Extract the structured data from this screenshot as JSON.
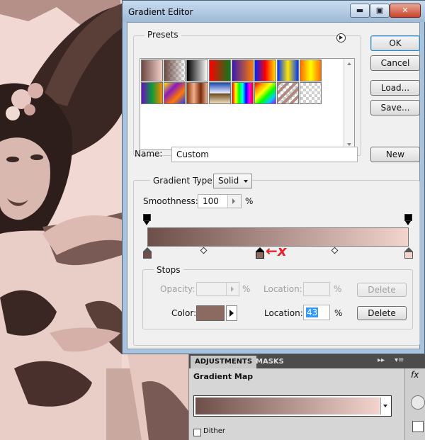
{
  "dialog": {
    "title": "Gradient Editor",
    "window_buttons": {
      "minimize": "▬",
      "maximize": "▣",
      "close": "✕"
    }
  },
  "presets": {
    "label": "Presets",
    "menu_icon": "circle-arrow-icon",
    "swatches": [
      {
        "name": "foreground-to-background",
        "css": "linear-gradient(90deg,#6b4a44,#f2d2cb)"
      },
      {
        "name": "foreground-to-transparent",
        "css": "linear-gradient(90deg,#6b4a44,rgba(107,74,68,0))",
        "checker": true
      },
      {
        "name": "black-white",
        "css": "linear-gradient(90deg,#000,#fff)"
      },
      {
        "name": "red-green",
        "css": "linear-gradient(90deg,#ff0000,#0a7a1a)"
      },
      {
        "name": "violet-orange",
        "css": "linear-gradient(90deg,#3a1ab0,#ff7a00)"
      },
      {
        "name": "blue-red-yellow",
        "css": "linear-gradient(90deg,#0022ff,#ff0000,#ffe600)"
      },
      {
        "name": "blue-yellow-blue",
        "css": "linear-gradient(90deg,#0038ff,#ffe600,#0038ff)"
      },
      {
        "name": "orange-yellow-orange",
        "css": "linear-gradient(90deg,#ff6a00,#ffff00,#ff6a00)"
      },
      {
        "name": "violet-green-orange",
        "css": "linear-gradient(90deg,#6a0fbf,#0a9a3a,#ff8a00)"
      },
      {
        "name": "yellow-violet-orange-blue",
        "css": "linear-gradient(135deg,#ffe600,#8a1ac0,#ff7a00,#1a3aff)"
      },
      {
        "name": "copper",
        "css": "linear-gradient(90deg,#8a3a12,#f2b08a,#7a2a0a,#f0c0a0)"
      },
      {
        "name": "chrome",
        "css": "linear-gradient(180deg,#1a4ab0,#f0f0ff 50%,#6a4a20 52%,#f0e0c0)"
      },
      {
        "name": "spectrum",
        "css": "linear-gradient(90deg,#ff0000,#ffff00,#00ff00,#00ffff,#0000ff,#ff00ff,#ff0000)"
      },
      {
        "name": "transparent-rainbow",
        "css": "linear-gradient(135deg,#ff0000,#ff9900,#ffff00,#00ff00,#00ccff,#aa00ff)",
        "checker": true
      },
      {
        "name": "transparent-stripes",
        "css": "repeating-linear-gradient(135deg,#b08a80 0 4px,rgba(255,255,255,0) 4px 8px)",
        "checker": true
      },
      {
        "name": "neutral-density",
        "css": "linear-gradient(90deg,rgba(0,0,0,0),rgba(0,0,0,0))",
        "checker": true
      }
    ]
  },
  "buttons": {
    "ok": "OK",
    "cancel": "Cancel",
    "load": "Load...",
    "save": "Save...",
    "new": "New"
  },
  "name": {
    "label": "Name:",
    "value": "Custom"
  },
  "gradient_type": {
    "label": "Gradient Type:",
    "value": "Solid"
  },
  "smoothness": {
    "label": "Smoothness:",
    "value": "100",
    "unit": "%"
  },
  "gradient": {
    "start_color": "#6d4e49",
    "end_color": "#f3d4cd",
    "color_stop_positions_percent": [
      0,
      43,
      100
    ],
    "midpoint_positions_percent": [
      21.5,
      71.5
    ],
    "opacity_stop_positions_percent": [
      0,
      100
    ]
  },
  "annotation": {
    "text": "←x",
    "color": "#e8232a"
  },
  "stops": {
    "label": "Stops",
    "opacity_label": "Opacity:",
    "opacity_unit": "%",
    "opacity_location_label": "Location:",
    "opacity_location_unit": "%",
    "opacity_delete": "Delete",
    "color_label": "Color:",
    "color_value": "#8b6a62",
    "location_label": "Location:",
    "location_value": "43",
    "location_unit": "%",
    "delete": "Delete"
  },
  "panel": {
    "tabs": [
      "ADJUSTMENTS",
      "MASKS"
    ],
    "menu_icons": [
      "double-arrow-icon",
      "panel-menu-icon"
    ],
    "title": "Gradient Map",
    "dither_label": "Dither",
    "preview_start": "#6d4e49",
    "preview_end": "#f3d4cd"
  }
}
